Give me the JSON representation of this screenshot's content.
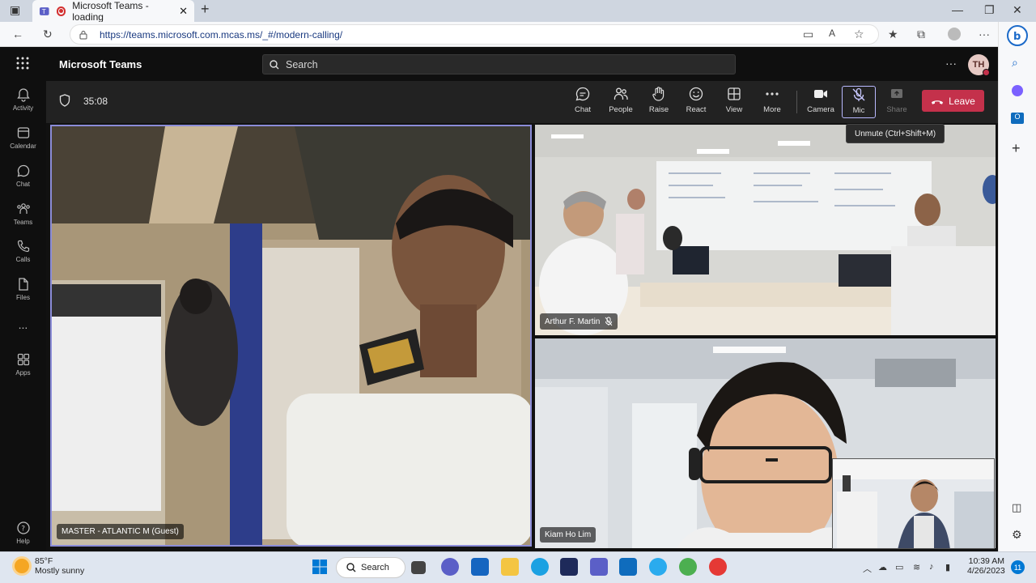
{
  "browser": {
    "tab_title": "Microsoft Teams - loading",
    "url": "https://teams.microsoft.com.mcas.ms/_#/modern-calling/"
  },
  "teams": {
    "app_name": "Microsoft Teams",
    "search_placeholder": "Search",
    "avatar_initials": "TH",
    "rail": [
      "Activity",
      "Calendar",
      "Chat",
      "Teams",
      "Calls",
      "Files",
      "...",
      "Apps",
      "Help"
    ]
  },
  "meeting": {
    "timer": "35:08",
    "controls": {
      "chat": "Chat",
      "people": "People",
      "raise": "Raise",
      "react": "React",
      "view": "View",
      "more": "More",
      "camera": "Camera",
      "mic": "Mic",
      "share": "Share",
      "leave": "Leave"
    },
    "tooltip": "Unmute (Ctrl+Shift+M)",
    "participants": [
      {
        "name": "MASTER - ATLANTIC M (Guest)"
      },
      {
        "name": "Arthur F. Martin"
      },
      {
        "name": "Kiam Ho Lim"
      }
    ]
  },
  "taskbar": {
    "temperature": "85°F",
    "weather": "Mostly sunny",
    "search_label": "Search",
    "time": "10:39 AM",
    "date": "4/26/2023",
    "notification_count": "11"
  },
  "colors": {
    "leave_red": "#c4314b",
    "active_border": "#8b8cd8",
    "teams_dark": "#0f0f0f"
  }
}
